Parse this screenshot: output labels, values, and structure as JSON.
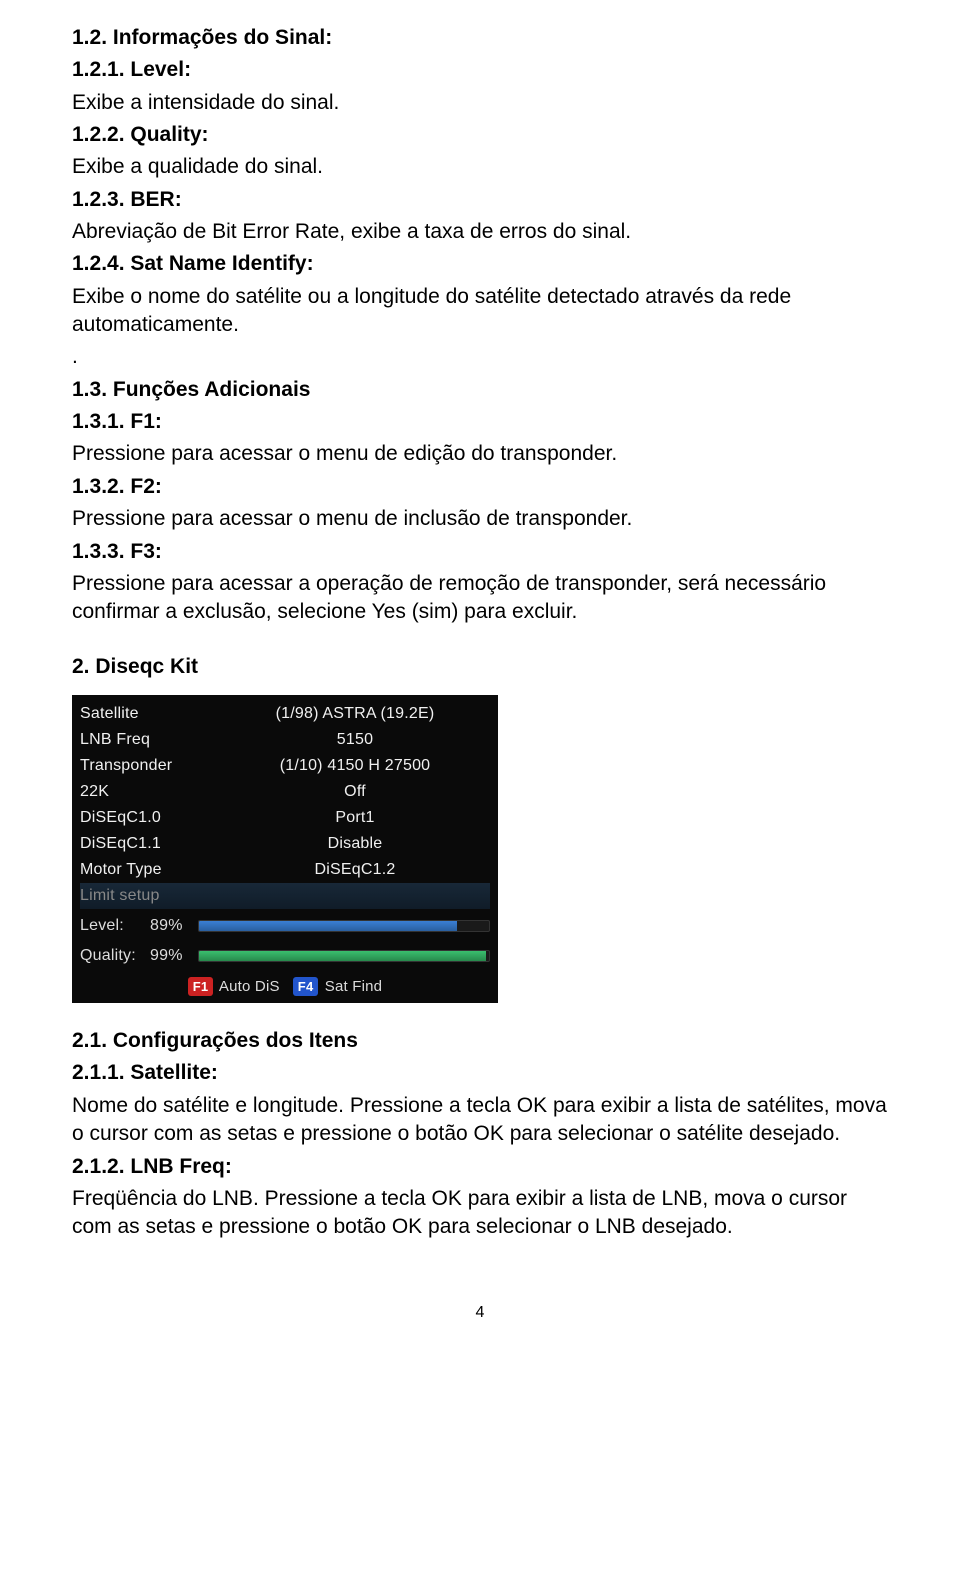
{
  "doc": {
    "s12": {
      "h": "1.2. Informações do Sinal:"
    },
    "s121": {
      "h": "1.2.1. Level:",
      "t": "Exibe a intensidade do sinal."
    },
    "s122": {
      "h": "1.2.2. Quality:",
      "t": "Exibe a qualidade do sinal."
    },
    "s123": {
      "h": "1.2.3. BER:",
      "t": "Abreviação de Bit Error Rate, exibe a taxa de erros do sinal."
    },
    "s124": {
      "h": "1.2.4. Sat Name Identify:",
      "t": "Exibe o nome do satélite ou a longitude do satélite detectado através da rede automaticamente."
    },
    "dot": ".",
    "s13": {
      "h": "1.3. Funções Adicionais"
    },
    "s131": {
      "h": "1.3.1. F1:",
      "t": "Pressione para acessar o menu de edição do transponder."
    },
    "s132": {
      "h": "1.3.2. F2:",
      "t": "Pressione para acessar o menu de inclusão de transponder."
    },
    "s133": {
      "h": "1.3.3. F3:",
      "t": "Pressione para acessar a operação de remoção de transponder, será necessário confirmar a exclusão, selecione Yes (sim) para excluir."
    },
    "s2": {
      "h": "2.  Diseqc Kit"
    },
    "s21": {
      "h": "2.1. Configurações dos Itens"
    },
    "s211": {
      "h": "2.1.1. Satellite:",
      "t": "Nome do satélite e longitude. Pressione a tecla OK para exibir a lista de satélites, mova o cursor com as setas e pressione o botão OK para selecionar o satélite desejado."
    },
    "s212": {
      "h": "2.1.2. LNB Freq:",
      "t": "Freqüência do LNB. Pressione a tecla OK para exibir a lista de LNB, mova o cursor com as setas e pressione o botão OK para selecionar o LNB desejado."
    },
    "pagenum": "4"
  },
  "osd": {
    "rows": {
      "satellite": {
        "label": "Satellite",
        "value": "(1/98) ASTRA (19.2E)"
      },
      "lnb": {
        "label": "LNB Freq",
        "value": "5150"
      },
      "transponder": {
        "label": "Transponder",
        "value": "(1/10) 4150 H 27500"
      },
      "k22": {
        "label": "22K",
        "value": "Off"
      },
      "diseqc10": {
        "label": "DiSEqC1.0",
        "value": "Port1"
      },
      "diseqc11": {
        "label": "DiSEqC1.1",
        "value": "Disable"
      },
      "motortype": {
        "label": "Motor Type",
        "value": "DiSEqC1.2"
      },
      "limit": {
        "label": "Limit setup"
      }
    },
    "level": {
      "label": "Level:",
      "pct": "89%",
      "value": 89
    },
    "quality": {
      "label": "Quality:",
      "pct": "99%",
      "value": 99
    },
    "foot": {
      "f1key": "F1",
      "f1lbl": "Auto DiS",
      "f4key": "F4",
      "f4lbl": "Sat Find"
    }
  }
}
